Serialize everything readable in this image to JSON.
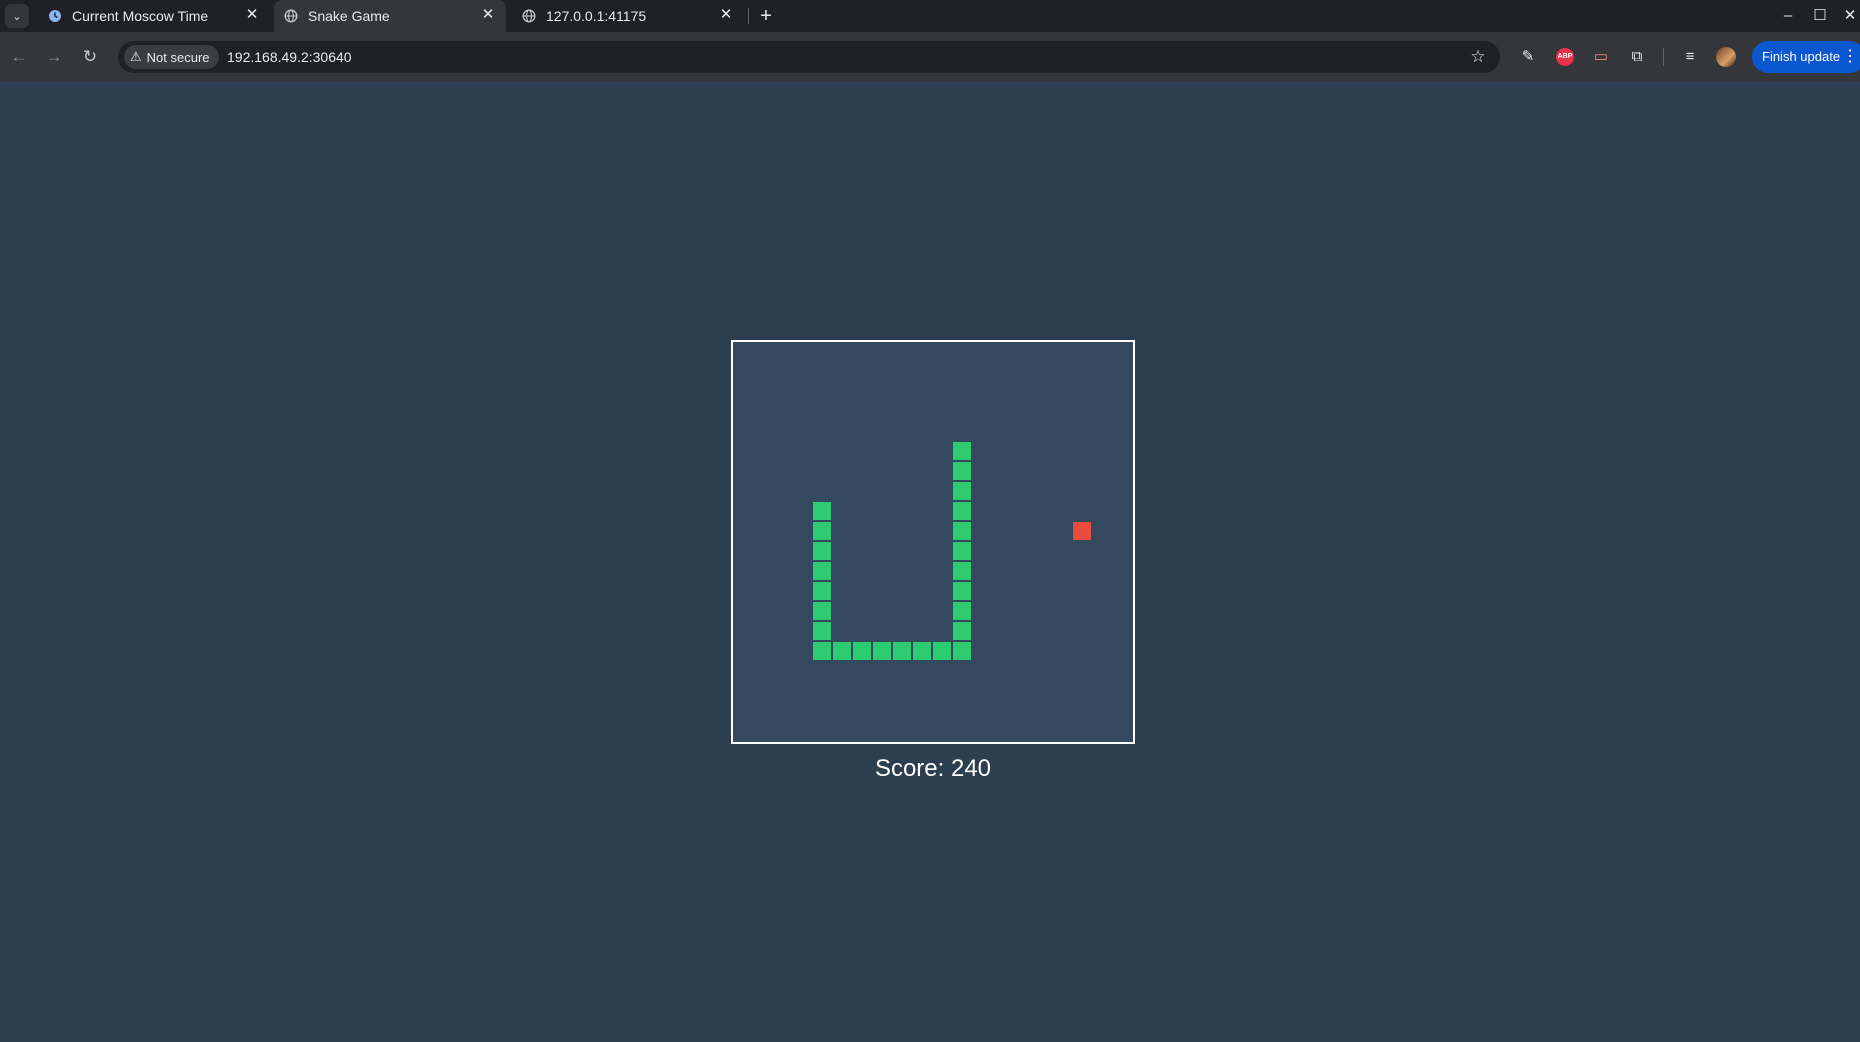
{
  "browser": {
    "tabs": [
      {
        "title": "Current Moscow Time",
        "favicon": "clock-icon",
        "active": false
      },
      {
        "title": "Snake Game",
        "favicon": "globe-icon",
        "active": true
      },
      {
        "title": "127.0.0.1:41175",
        "favicon": "globe-icon",
        "active": false
      }
    ],
    "security_label": "Not secure",
    "url": "192.168.49.2:30640",
    "update_button_label": "Finish update",
    "accent_color": "#0b57d0"
  },
  "game": {
    "score_text": "Score: 240",
    "grid_columns": 20,
    "grid_rows": 20,
    "snake_color": "#2ecc71",
    "food_color": "#e74c3c",
    "board_color": "#34495e",
    "page_color": "#2c3e50",
    "snake": [
      [
        11,
        5
      ],
      [
        11,
        6
      ],
      [
        11,
        7
      ],
      [
        11,
        8
      ],
      [
        11,
        9
      ],
      [
        11,
        10
      ],
      [
        11,
        11
      ],
      [
        11,
        12
      ],
      [
        11,
        13
      ],
      [
        11,
        14
      ],
      [
        11,
        15
      ],
      [
        10,
        15
      ],
      [
        9,
        15
      ],
      [
        8,
        15
      ],
      [
        7,
        15
      ],
      [
        6,
        15
      ],
      [
        5,
        15
      ],
      [
        4,
        15
      ],
      [
        4,
        14
      ],
      [
        4,
        13
      ],
      [
        4,
        12
      ],
      [
        4,
        11
      ],
      [
        4,
        10
      ],
      [
        4,
        9
      ],
      [
        4,
        8
      ]
    ],
    "food": [
      17,
      9
    ]
  }
}
